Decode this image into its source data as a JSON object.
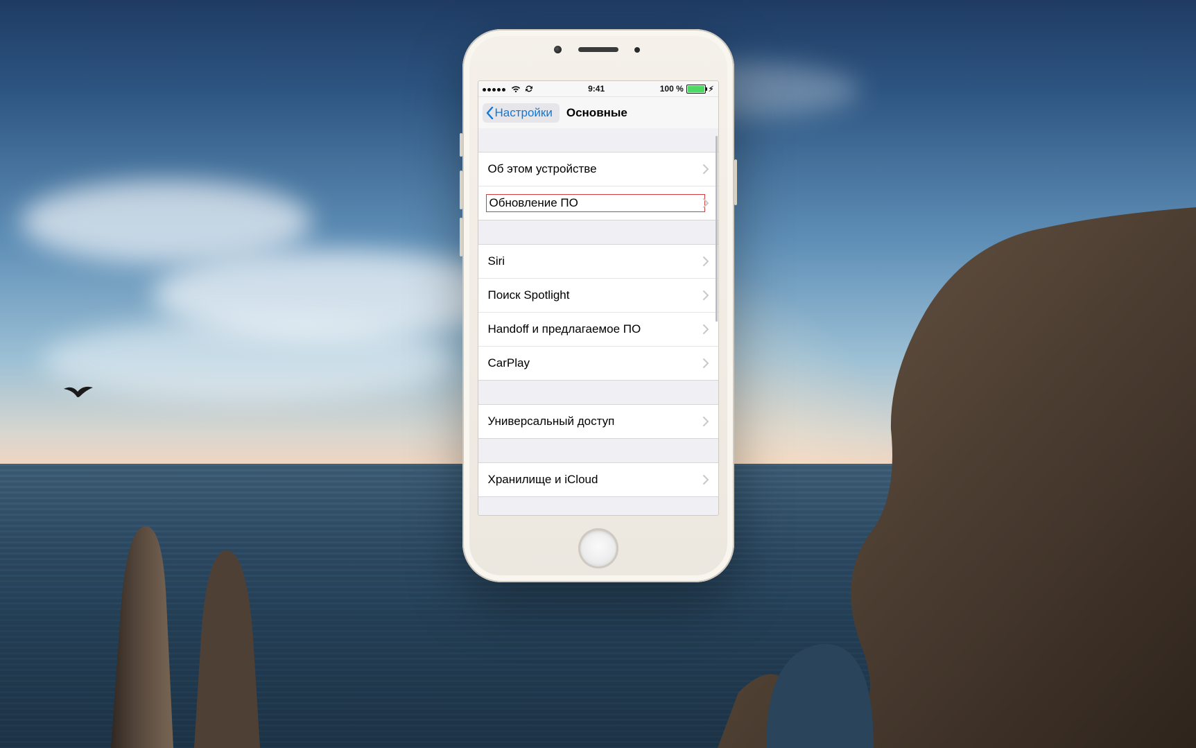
{
  "statusbar": {
    "time": "9:41",
    "battery_text": "100 %",
    "signal_dots": 5
  },
  "navbar": {
    "back_label": "Настройки",
    "title": "Основные"
  },
  "groups": [
    {
      "cells": [
        {
          "label": "Об этом устройстве",
          "highlight": false
        },
        {
          "label": "Обновление ПО",
          "highlight": true
        }
      ]
    },
    {
      "cells": [
        {
          "label": "Siri"
        },
        {
          "label": "Поиск Spotlight"
        },
        {
          "label": "Handoff и предлагаемое ПО"
        },
        {
          "label": "CarPlay"
        }
      ]
    },
    {
      "cells": [
        {
          "label": "Универсальный доступ"
        }
      ]
    },
    {
      "cells": [
        {
          "label": "Хранилище и iCloud"
        }
      ]
    }
  ],
  "scroll": {
    "thumb_top_pct": 2,
    "thumb_height_pct": 48
  }
}
